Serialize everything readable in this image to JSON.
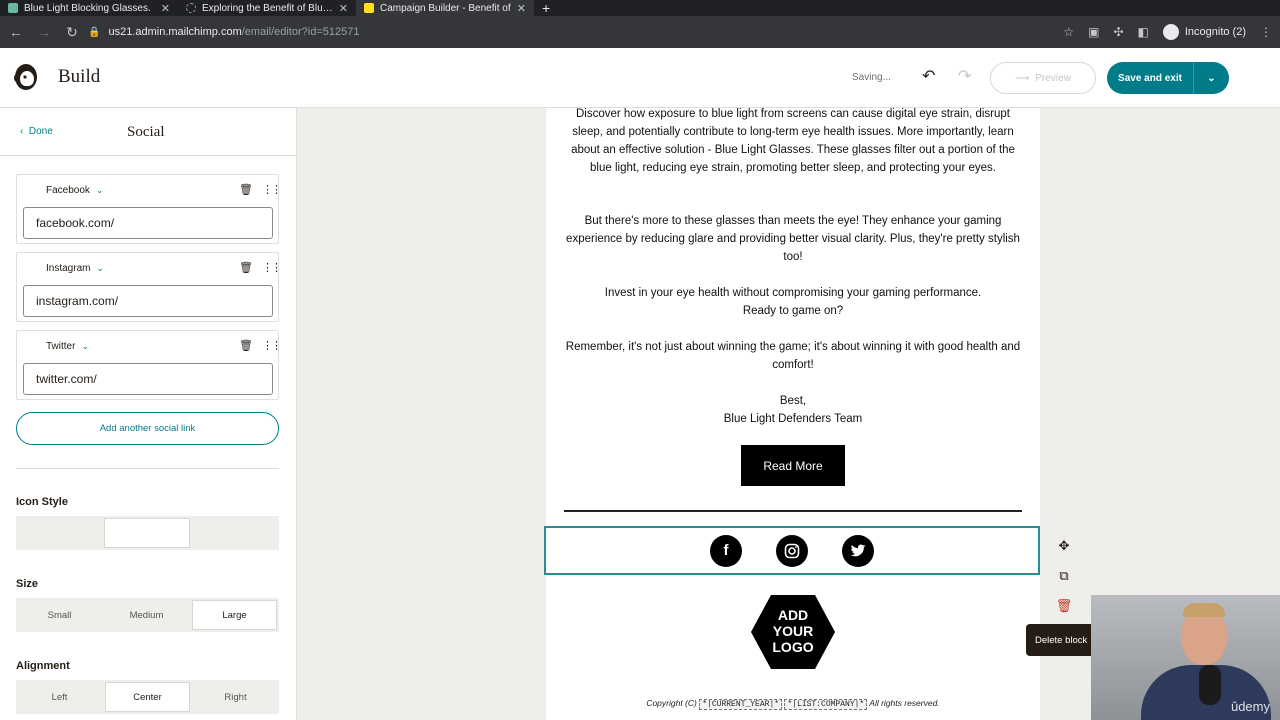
{
  "browser": {
    "tabs": [
      {
        "title": "Blue Light Blocking Glasses.",
        "active": false
      },
      {
        "title": "Exploring the Benefit of Blue Li",
        "active": false
      },
      {
        "title": "Campaign Builder - Benefit of",
        "active": true
      }
    ],
    "url_host": "us21.admin.mailchimp.com",
    "url_path": "/email/editor?id=512571",
    "profile": "Incognito (2)"
  },
  "header": {
    "title": "Build",
    "status": "Saving...",
    "preview_label": "Preview",
    "save_exit_label": "Save and exit"
  },
  "panel": {
    "back_label": "Done",
    "title": "Social",
    "links": [
      {
        "network": "Facebook",
        "value": "facebook.com/"
      },
      {
        "network": "Instagram",
        "value": "instagram.com/"
      },
      {
        "network": "Twitter",
        "value": "twitter.com/"
      }
    ],
    "add_link_label": "Add another social link",
    "icon_style_label": "Icon Style",
    "size_label": "Size",
    "size_options": [
      "Small",
      "Medium",
      "Large"
    ],
    "size_selected": "Large",
    "alignment_label": "Alignment",
    "alignment_options": [
      "Left",
      "Center",
      "Right"
    ],
    "alignment_selected": "Center"
  },
  "email": {
    "paragraphs": [
      "Discover how exposure to blue light from screens can cause digital eye strain, disrupt sleep, and potentially contribute to long-term eye health issues. More importantly, learn about an effective solution - Blue Light Glasses. These glasses filter out a portion of the blue light, reducing eye strain, promoting better sleep, and protecting your eyes.",
      "But there's more to these glasses than meets the eye! They enhance your gaming experience by reducing glare and providing better visual clarity. Plus, they're pretty stylish too!",
      "Invest in your eye health without compromising your gaming performance.\nReady to game on?",
      "Remember, it's not just about winning the game; it's about winning it with good health and comfort!",
      "Best,\nBlue Light Defenders Team"
    ],
    "button_label": "Read More",
    "social_icons": [
      {
        "name": "facebook-icon",
        "glyph": "f"
      },
      {
        "name": "instagram-icon",
        "glyph": "◎"
      },
      {
        "name": "twitter-icon",
        "glyph": "🐦"
      }
    ],
    "logo_text": [
      "ADD",
      "YOUR",
      "LOGO"
    ],
    "copyright_prefix": "Copyright (C)",
    "copyright_tag1": "*|CURRENT_YEAR|*",
    "copyright_tag2": "*|LIST:COMPANY|*",
    "copyright_suffix": "All rights reserved."
  },
  "block_tools": {
    "tooltip": "Delete block"
  },
  "webcam": {
    "watermark": "ûdemy"
  },
  "colors": {
    "accent": "#007c89",
    "canvas_bg": "#efeeea",
    "selection_border": "#2e8b94"
  }
}
